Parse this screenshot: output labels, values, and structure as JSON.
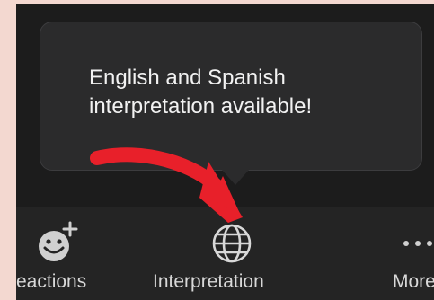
{
  "tooltip": {
    "line1": "English and Spanish",
    "line2": "interpretation available!"
  },
  "toolbar": {
    "reactions_label": "eactions",
    "interpretation_label": "Interpretation",
    "more_label": "More"
  },
  "icons": {
    "reactions": "smiley-add-icon",
    "interpretation": "globe-icon",
    "more": "ellipsis-icon"
  },
  "colors": {
    "arrow": "#e8202a",
    "tooltip_bg": "#2b2b2c",
    "toolbar_bg": "#242424"
  }
}
